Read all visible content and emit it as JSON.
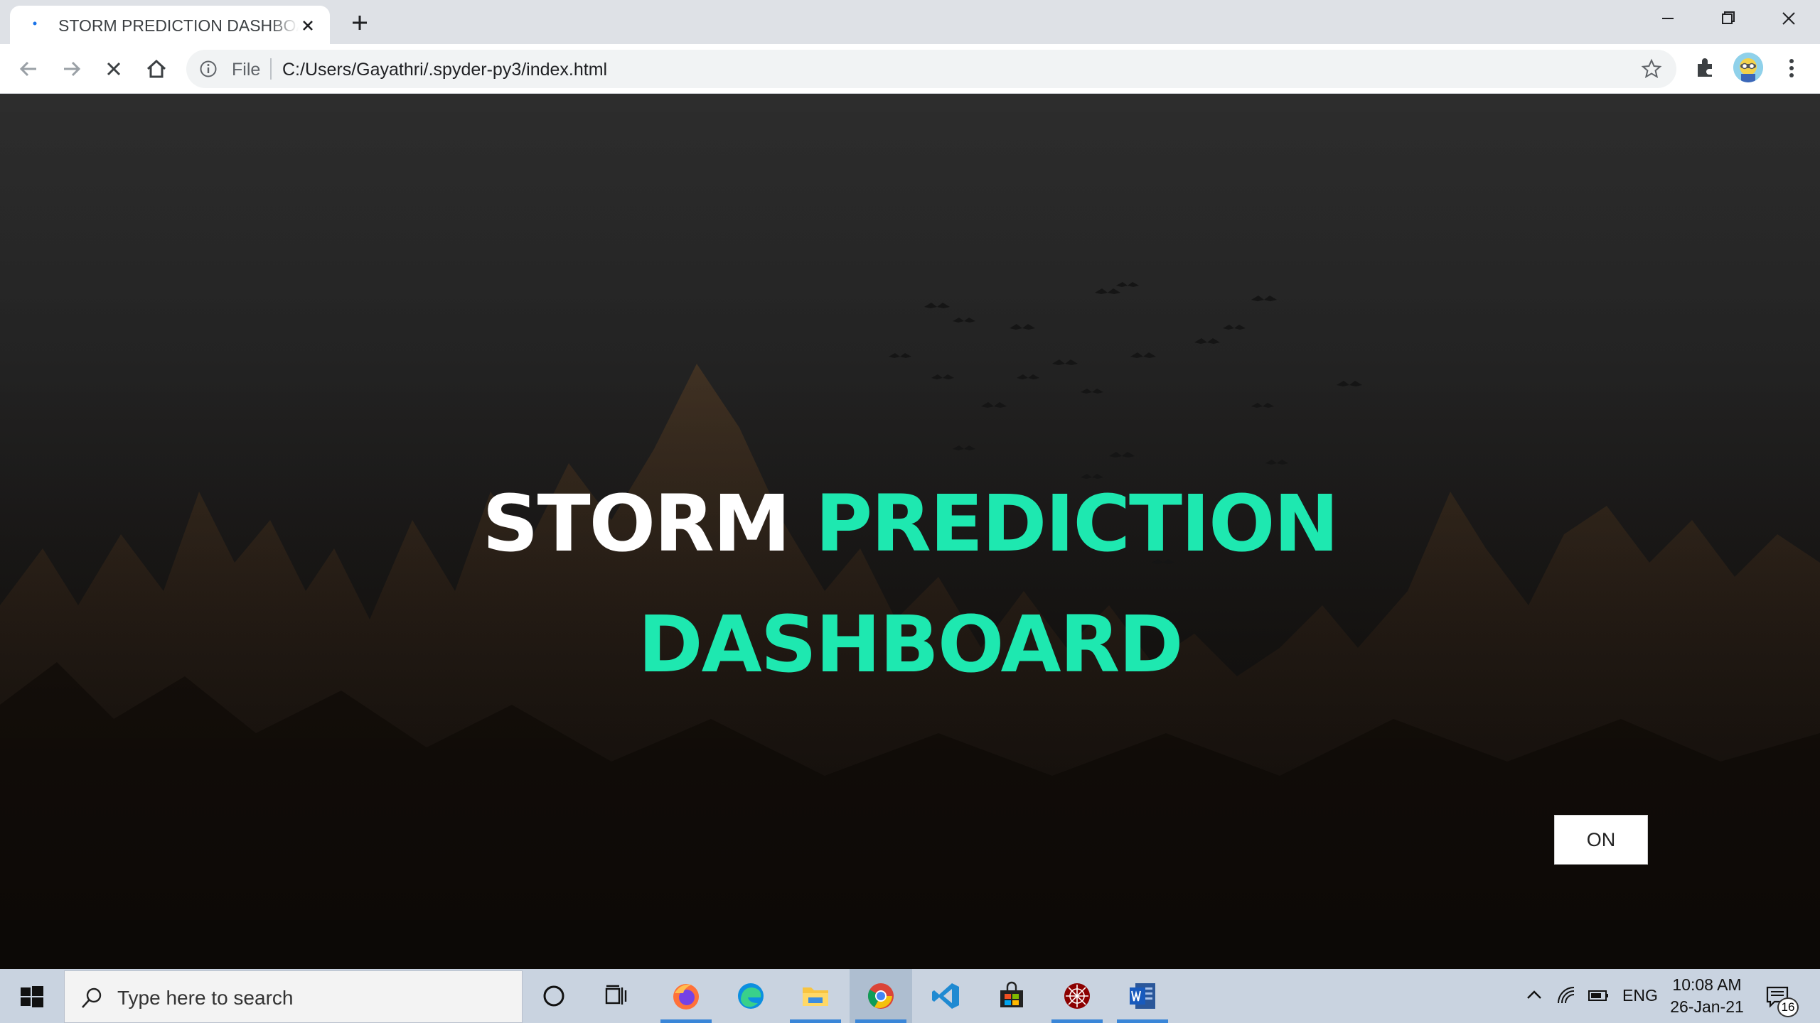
{
  "browser": {
    "tab_title": "STORM PREDICTION DASHBOARD",
    "file_label": "File",
    "url": "C:/Users/Gayathri/.spyder-py3/index.html"
  },
  "hero": {
    "word_white": "STORM",
    "word_accent": "PREDICTION",
    "line2": "DASHBOARD",
    "white_color": "#ffffff",
    "accent_color": "#1ee8b0"
  },
  "toggle_button": {
    "label": "ON"
  },
  "taskbar": {
    "search_placeholder": "Type here to search",
    "language": "ENG",
    "time": "10:08 AM",
    "date": "26-Jan-21",
    "notification_count": "16",
    "apps": [
      "cortana-icon",
      "task-view-icon",
      "firefox-icon",
      "edge-icon",
      "file-explorer-icon",
      "chrome-icon",
      "vscode-icon",
      "store-icon",
      "spyder-icon",
      "word-icon"
    ]
  }
}
